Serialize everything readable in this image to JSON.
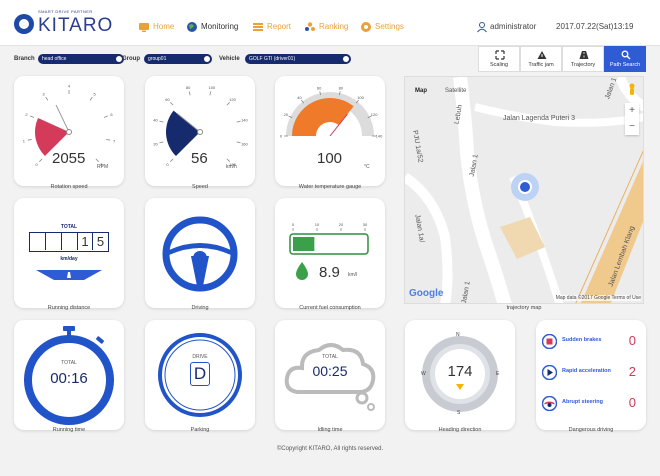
{
  "header": {
    "logo_tagline": "SMART DRIVE PARTNER",
    "logo_text": "KITARO",
    "nav": [
      {
        "label": "Home",
        "color": "#e8a23a"
      },
      {
        "label": "Monitoring",
        "color": "#333333"
      },
      {
        "label": "Report",
        "color": "#e8a23a"
      },
      {
        "label": "Ranking",
        "color": "#e8a23a"
      },
      {
        "label": "Settings",
        "color": "#e8a23a"
      }
    ],
    "user": "administrator",
    "datetime": "2017.07.22(Sat)13:19"
  },
  "filters": {
    "branch_label": "Branch",
    "branch_value": "head office",
    "group_label": "Group",
    "group_value": "group01",
    "vehicle_label": "Vehicle",
    "vehicle_value": "GOLF GTI (driver01)"
  },
  "map_toolbar": [
    "Scaling",
    "Traffic jam",
    "Trajectory",
    "Path Search"
  ],
  "cards": {
    "rotation": {
      "value": "2055",
      "unit": "RPM",
      "caption": "Rotation speed",
      "ticks": [
        "0",
        "1",
        "2",
        "3",
        "4",
        "5",
        "6",
        "7",
        "8"
      ]
    },
    "speed": {
      "value": "56",
      "unit": "km/h",
      "caption": "Speed",
      "ticks": [
        "0",
        "20",
        "40",
        "60",
        "80",
        "100",
        "120",
        "140",
        "160",
        "180"
      ]
    },
    "water": {
      "value": "100",
      "unit": "°C",
      "caption": "Water temperature gauge",
      "ticks": [
        "0",
        "20",
        "40",
        "60",
        "80",
        "100",
        "120",
        "140"
      ]
    },
    "distance": {
      "label_top": "TOTAL",
      "digits": [
        "",
        "",
        "",
        "1",
        "5"
      ],
      "label_bottom": "km/day",
      "caption": "Running distance"
    },
    "driving": {
      "caption": "Driving"
    },
    "fuel": {
      "ticks": [
        "0",
        "10",
        "20",
        "30"
      ],
      "value": "8.9",
      "unit": "km/l",
      "caption": "Current fuel consumption"
    },
    "running_time": {
      "label_top": "TOTAL",
      "value": "00:16",
      "caption": "Running time"
    },
    "parking": {
      "label_top": "DRIVE",
      "value": "D",
      "caption": "Parking"
    },
    "idling": {
      "label_top": "TOTAL",
      "value": "00:25",
      "caption": "Idling time"
    },
    "heading": {
      "value": "174",
      "caption": "Heading direction",
      "n": "N",
      "s": "S",
      "e": "E",
      "w": "W"
    }
  },
  "map": {
    "tab_map": "Map",
    "tab_satellite": "Satellite",
    "street_1": "Jalan Lagenda Puteri 3",
    "street_2": "Jalan 1",
    "street_3": "PJU 1a/52",
    "street_4": "Jalan 1a/",
    "street_5": "Jalan Lembah Klang",
    "street_6": "Lebuh",
    "street_7": "Jalan 1",
    "street_8": "Jalan 1",
    "google": "Google",
    "attribution": "Map data ©2017 Google   Terms of Use",
    "caption": "trajectory map"
  },
  "danger": {
    "caption": "Dangerous driving",
    "rows": [
      {
        "label": "Sudden brakes",
        "count": "0"
      },
      {
        "label": "Rapid acceleration",
        "count": "2"
      },
      {
        "label": "Abrupt steering",
        "count": "0"
      }
    ]
  },
  "footer": "©Copyright KITARO, All rights reserved.",
  "colors": {
    "accent": "#2f5bd4",
    "navy": "#162a6e",
    "rpm": "#d43a5a",
    "temp": "#ef7a2a",
    "fuel": "#3aa04a",
    "nav_orange": "#e8a23a"
  }
}
